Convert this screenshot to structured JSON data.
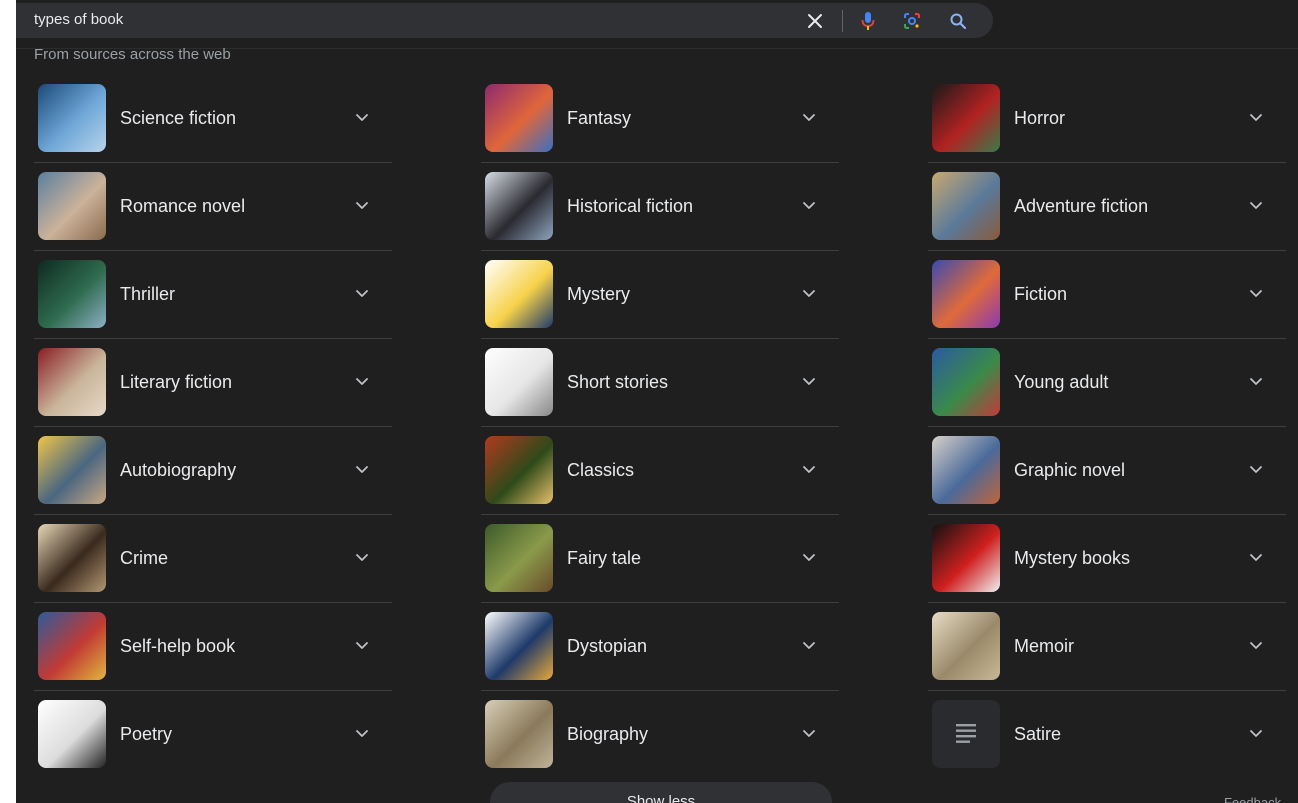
{
  "search": {
    "query": "types of book"
  },
  "source_label": "From sources across the web",
  "columns": [
    [
      {
        "label": "Science fiction",
        "thumb_colors": [
          "#1c4a7a",
          "#6ea7d8",
          "#b8d4ea"
        ]
      },
      {
        "label": "Romance novel",
        "thumb_colors": [
          "#5a7fa0",
          "#cbb29a",
          "#8a6b4d"
        ]
      },
      {
        "label": "Thriller",
        "thumb_colors": [
          "#0e2a22",
          "#2f6b4e",
          "#8cb0c6"
        ]
      },
      {
        "label": "Literary fiction",
        "thumb_colors": [
          "#8a1e24",
          "#c9b49a",
          "#e7d9c7"
        ]
      },
      {
        "label": "Autobiography",
        "thumb_colors": [
          "#f0c54a",
          "#4a6680",
          "#c8a882"
        ]
      },
      {
        "label": "Crime",
        "thumb_colors": [
          "#e7d7b6",
          "#3a2a1e",
          "#b39772"
        ]
      },
      {
        "label": "Self-help book",
        "thumb_colors": [
          "#2e5b9a",
          "#c23a34",
          "#e0b63c"
        ]
      },
      {
        "label": "Poetry",
        "thumb_colors": [
          "#ffffff",
          "#dddddd",
          "#222222"
        ]
      }
    ],
    [
      {
        "label": "Fantasy",
        "thumb_colors": [
          "#8e2a6e",
          "#e0663a",
          "#3b6fc2"
        ]
      },
      {
        "label": "Historical fiction",
        "thumb_colors": [
          "#d8dde6",
          "#2a2a30",
          "#8ea4bf"
        ]
      },
      {
        "label": "Mystery",
        "thumb_colors": [
          "#ffffff",
          "#f7d24a",
          "#1e3a6a"
        ]
      },
      {
        "label": "Short stories",
        "thumb_colors": [
          "#ffffff",
          "#e6e6e6",
          "#888888"
        ]
      },
      {
        "label": "Classics",
        "thumb_colors": [
          "#b23a1e",
          "#2e4a1a",
          "#e6c06a"
        ]
      },
      {
        "label": "Fairy tale",
        "thumb_colors": [
          "#3c5a2a",
          "#8a9a4a",
          "#6a4a2a"
        ]
      },
      {
        "label": "Dystopian",
        "thumb_colors": [
          "#ffffff",
          "#1e3a6a",
          "#e8a83a"
        ]
      },
      {
        "label": "Biography",
        "thumb_colors": [
          "#d8cfb8",
          "#8a7a5a",
          "#bfb39a"
        ]
      }
    ],
    [
      {
        "label": "Horror",
        "thumb_colors": [
          "#1a1a1a",
          "#b22222",
          "#3a7a4a"
        ]
      },
      {
        "label": "Adventure fiction",
        "thumb_colors": [
          "#c9a870",
          "#5a7a9a",
          "#8a5a3a"
        ]
      },
      {
        "label": "Fiction",
        "thumb_colors": [
          "#3a4ab2",
          "#e06a3a",
          "#8a3ab2"
        ]
      },
      {
        "label": "Young adult",
        "thumb_colors": [
          "#2a5aa0",
          "#3a8a4a",
          "#c23a3a"
        ]
      },
      {
        "label": "Graphic novel",
        "thumb_colors": [
          "#d8d0c8",
          "#4a6a9a",
          "#c2643a"
        ]
      },
      {
        "label": "Mystery books",
        "thumb_colors": [
          "#111111",
          "#d02020",
          "#f0f0f0"
        ]
      },
      {
        "label": "Memoir",
        "thumb_colors": [
          "#e6dcc4",
          "#9a8a6a",
          "#c8b898"
        ]
      },
      {
        "label": "Satire",
        "thumb_colors": [
          "#2a2b2e",
          "#2a2b2e",
          "#9aa0a6"
        ],
        "icon": "text-lines-icon"
      }
    ]
  ],
  "show_less_label": "Show less",
  "feedback_label": "Feedback"
}
